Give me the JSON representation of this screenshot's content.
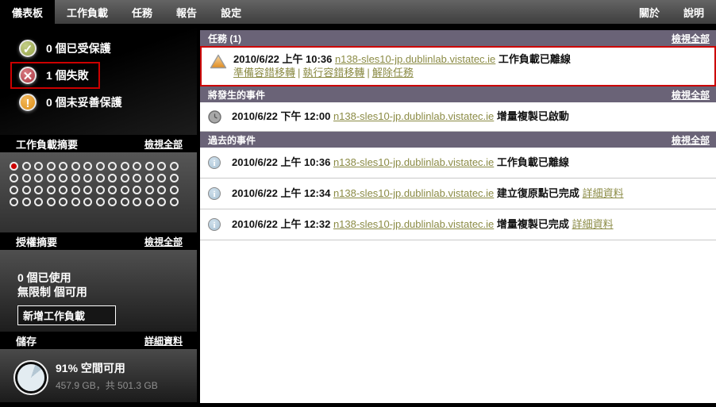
{
  "topnav": {
    "items": [
      {
        "label": "儀表板",
        "active": true
      },
      {
        "label": "工作負載",
        "active": false
      },
      {
        "label": "任務",
        "active": false
      },
      {
        "label": "報告",
        "active": false
      },
      {
        "label": "設定",
        "active": false
      }
    ],
    "right_items": [
      {
        "label": "關於"
      },
      {
        "label": "說明"
      }
    ]
  },
  "sidebar": {
    "status": [
      {
        "icon": "check-circle-icon",
        "label": "0 個已受保護",
        "highlighted": false
      },
      {
        "icon": "x-circle-icon",
        "label": "1 個失敗",
        "highlighted": true
      },
      {
        "icon": "exclamation-circle-icon",
        "label": "0 個未妥善保護",
        "highlighted": false
      }
    ],
    "workload_summary": {
      "title": "工作負載摘要",
      "view_all_label": "檢視全部",
      "grid": {
        "columns": 14,
        "rows": 4,
        "total": 56,
        "failed_index": 0,
        "failed_color": "#cc0000"
      }
    },
    "license_summary": {
      "title": "授權摘要",
      "view_all_label": "檢視全部",
      "used_line": "0 個已使用",
      "available_line": "無限制 個可用",
      "add_button_label": "新增工作負載"
    },
    "storage": {
      "title": "儲存",
      "details_label": "詳細資料",
      "percent_line": "91% 空間可用",
      "size_line": "457.9 GB，共 501.3 GB"
    }
  },
  "main": {
    "tasks": {
      "title": "任務 (1)",
      "view_all_label": "檢視全部",
      "action_separator": "|",
      "rows": [
        {
          "icon": "warning-triangle-icon",
          "timestamp": "2010/6/22 上午 10:36",
          "host_link": "n138-sles10-jp.dublinlab.vistatec.ie",
          "message": "工作負載已離線",
          "actions": [
            "準備容錯移轉",
            "執行容錯移轉",
            "解除任務"
          ]
        }
      ]
    },
    "upcoming_events": {
      "title": "將發生的事件",
      "view_all_label": "檢視全部",
      "rows": [
        {
          "icon": "clock-icon",
          "timestamp": "2010/6/22 下午 12:00",
          "host_link": "n138-sles10-jp.dublinlab.vistatec.ie",
          "message": "增量複製已啟動"
        }
      ]
    },
    "past_events": {
      "title": "過去的事件",
      "view_all_label": "檢視全部",
      "rows": [
        {
          "icon": "info-icon",
          "timestamp": "2010/6/22 上午 10:36",
          "host_link": "n138-sles10-jp.dublinlab.vistatec.ie",
          "message": "工作負載已離線",
          "details_label": ""
        },
        {
          "icon": "info-icon",
          "timestamp": "2010/6/22 上午 12:34",
          "host_link": "n138-sles10-jp.dublinlab.vistatec.ie",
          "message": "建立復原點已完成",
          "details_label": "詳細資料"
        },
        {
          "icon": "info-icon",
          "timestamp": "2010/6/22 上午 12:32",
          "host_link": "n138-sles10-jp.dublinlab.vistatec.ie",
          "message": "增量複製已完成",
          "details_label": "詳細資料"
        }
      ]
    }
  },
  "colors": {
    "link_olive": "#8b8b45",
    "section_header_purple": "#6a6377",
    "alert_red": "#cc0000",
    "ok_green": "#96a347",
    "fail_red": "#a93742",
    "warn_orange": "#dd8d14"
  }
}
